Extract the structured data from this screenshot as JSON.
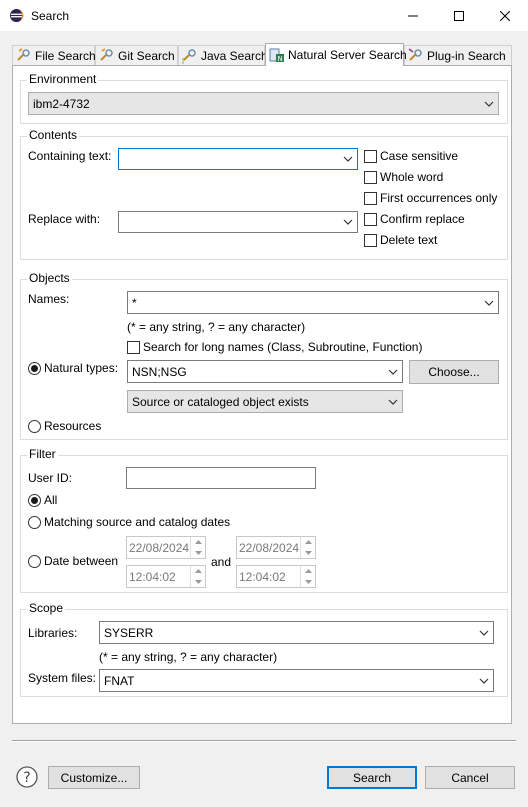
{
  "window": {
    "title": "Search"
  },
  "tabs": [
    {
      "label": "File Search",
      "icon": "file-search-icon"
    },
    {
      "label": "Git Search",
      "icon": "git-search-icon"
    },
    {
      "label": "Java Search",
      "icon": "java-search-icon"
    },
    {
      "label": "Natural Server Search",
      "icon": "natural-server-search-icon",
      "active": true
    },
    {
      "label": "Plug-in Search",
      "icon": "plugin-search-icon"
    }
  ],
  "environment": {
    "label": "Environment",
    "value": "ibm2-4732"
  },
  "contents": {
    "label": "Contents",
    "containing_label": "Containing text:",
    "containing_value": "",
    "replace_label": "Replace with:",
    "replace_value": "",
    "options": [
      {
        "label": "Case sensitive",
        "checked": false
      },
      {
        "label": "Whole word",
        "checked": false
      },
      {
        "label": "First occurrences only",
        "checked": false
      },
      {
        "label": "Confirm replace",
        "checked": false
      },
      {
        "label": "Delete text",
        "checked": false
      }
    ]
  },
  "objects": {
    "label": "Objects",
    "names_label": "Names:",
    "names_value": "*",
    "hint": "(* = any string, ? = any character)",
    "long_names_label": "Search for long names (Class, Subroutine, Function)",
    "natural_types_label": "Natural types:",
    "natural_types_value": "NSN;NSG",
    "choose_label": "Choose...",
    "existence_value": "Source or cataloged object exists",
    "resources_label": "Resources"
  },
  "filter": {
    "label": "Filter",
    "userid_label": "User ID:",
    "userid_value": "",
    "all_label": "All",
    "matching_label": "Matching source and catalog dates",
    "date_between_label": "Date between",
    "and_label": "and",
    "from_date": "22/08/2024",
    "from_time": "12:04:02",
    "to_date": "22/08/2024",
    "to_time": "12:04:02"
  },
  "scope": {
    "label": "Scope",
    "libraries_label": "Libraries:",
    "libraries_value": "SYSERR",
    "hint": "(* = any string, ? = any character)",
    "sysfiles_label": "System files:",
    "sysfiles_value": "FNAT"
  },
  "footer": {
    "customize_label": "Customize...",
    "search_label": "Search",
    "cancel_label": "Cancel"
  },
  "colors": {
    "accent": "#0078d7"
  }
}
